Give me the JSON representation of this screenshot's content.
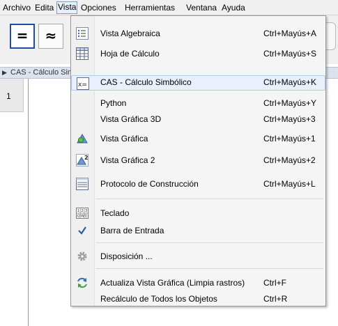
{
  "menubar": {
    "items": [
      "Archivo",
      "Edita",
      "Vista",
      "Opciones",
      "Herramientas",
      "Ventana",
      "Ayuda"
    ]
  },
  "toolbar": {
    "buttons": [
      {
        "glyph": "=",
        "icon": "evaluate-icon"
      },
      {
        "glyph": "≈",
        "icon": "numeric-icon"
      }
    ]
  },
  "cas": {
    "title": "CAS - Cálculo Simbólico",
    "rows": [
      "1"
    ]
  },
  "vista_menu": {
    "items": [
      {
        "label": "Vista Algebraica",
        "shortcut": "Ctrl+Mayús+A",
        "icon": "algebra-view-icon"
      },
      {
        "label": "Hoja de Cálculo",
        "shortcut": "Ctrl+Mayús+S",
        "icon": "spreadsheet-icon"
      },
      {
        "label": "CAS - Cálculo Simbólico",
        "shortcut": "Ctrl+Mayús+K",
        "icon": "cas-icon"
      },
      {
        "label": "Python",
        "shortcut": "Ctrl+Mayús+Y",
        "icon": ""
      },
      {
        "label": "Vista Gráfica 3D",
        "shortcut": "Ctrl+Mayús+3",
        "icon": ""
      },
      {
        "label": "Vista Gráfica",
        "shortcut": "Ctrl+Mayús+1",
        "icon": "graphics-view-icon"
      },
      {
        "label": "Vista Gráfica 2",
        "shortcut": "Ctrl+Mayús+2",
        "icon": "graphics-view-2-icon"
      },
      {
        "label": "Protocolo de Construcción",
        "shortcut": "Ctrl+Mayús+L",
        "icon": "construction-protocol-icon"
      },
      {
        "label": "Teclado",
        "shortcut": "",
        "icon": "keyboard-icon"
      },
      {
        "label": "Barra de Entrada",
        "shortcut": "",
        "icon": "checkmark-icon"
      },
      {
        "label": "Disposición ...",
        "shortcut": "",
        "icon": "gear-icon"
      },
      {
        "label": "Actualiza Vista Gráfica (Limpia rastros)",
        "shortcut": "Ctrl+F",
        "icon": "refresh-icon"
      },
      {
        "label": "Recálculo de Todos los Objetos",
        "shortcut": "Ctrl+R",
        "icon": ""
      }
    ],
    "highlighted": "CAS - Cálculo Simbólico",
    "checked": "Barra de Entrada",
    "icon_superscript": "2",
    "keyboard_glyphs": [
      "1",
      "2",
      "3",
      "Q",
      "W",
      "E"
    ]
  }
}
